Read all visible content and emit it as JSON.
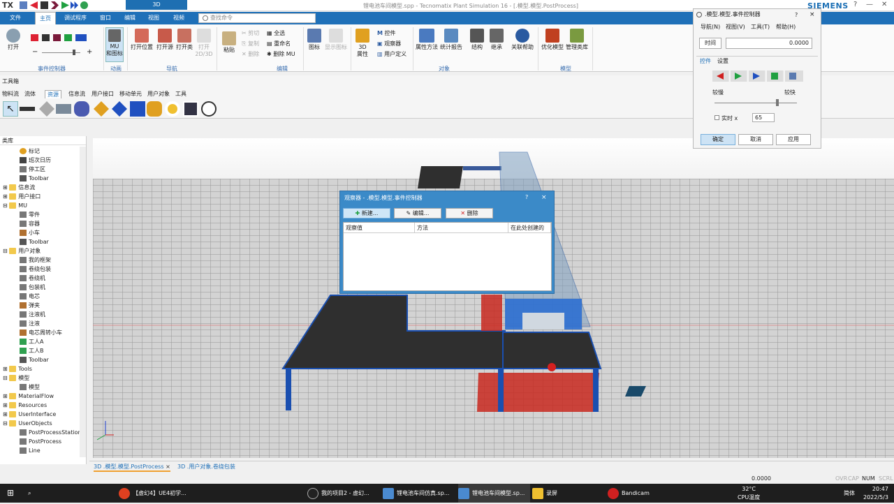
{
  "app": {
    "logo": "TX",
    "window_title": "锂电池车间模型.spp - Tecnomatix Plant Simulation 16 - [.模型.模型.PostProcess]",
    "context_tab": "3D",
    "brand": "SIEMENS"
  },
  "ribbon_tabs": [
    "文件",
    "主页",
    "调试程序",
    "窗口",
    "编辑",
    "视图",
    "视频"
  ],
  "search": {
    "placeholder": "查找命令"
  },
  "ribbon": {
    "open": "打开",
    "event_group": "事件控制器",
    "mu_line1": "MU",
    "mu_line2": "和图标",
    "anim_group": "动画",
    "open_loc": "打开位置",
    "open_src": "打开源",
    "open_class": "打开类",
    "open_2d": "打开",
    "open_2d_b": "2D/3D",
    "nav_group": "导航",
    "paste": "粘贴",
    "cut": "剪切",
    "copy": "复制",
    "delete": "删除",
    "select_all": "全选",
    "rename": "重命名",
    "delete_mu": "删除 MU",
    "edit_group": "编辑",
    "icon": "图标",
    "show_icon": "显示图标",
    "attr3d": "3D",
    "attr3d_b": "属性",
    "control": "控件",
    "observer": "观察器",
    "user_def": "用户定义",
    "props": "属性方法",
    "stats": "统计报告",
    "structure": "结构",
    "inherit": "继承",
    "related": "关联帮助",
    "obj_group": "对象",
    "optimize": "优化模型",
    "manage_lib": "管理类库",
    "model_group": "模型"
  },
  "toolbox": {
    "title": "工具箱",
    "tabs": [
      "物料流",
      "流体",
      "资源",
      "信息流",
      "用户接口",
      "移动单元",
      "用户对象",
      "工具"
    ]
  },
  "library": {
    "title": "类库",
    "items": [
      "标记",
      "班次日历",
      "停工区",
      "Toolbar",
      "信息流",
      "用户接口",
      "MU",
      "零件",
      "容器",
      "小车",
      "Toolbar",
      "用户对象",
      "我的框架",
      "卷绕包装",
      "卷绕机",
      "包装机",
      "电芯",
      "弹夹",
      "注液机",
      "注液",
      "电芯周转小车",
      "工人A",
      "工人B",
      "Toolbar",
      "Tools",
      "模型",
      "模型",
      "MaterialFlow",
      "Resources",
      "UserInterface",
      "UserObjects",
      "PostProcessStation",
      "PostProcess",
      "Line"
    ]
  },
  "observer_dialog": {
    "title": "观察器 - .模型.模型.事件控制器",
    "help": "?",
    "close": "×",
    "new": "新建...",
    "edit": "编辑...",
    "delete": "删除",
    "col_value": "观察值",
    "col_method": "方法",
    "col_created": "在此处创建的"
  },
  "event_controller": {
    "title": ".模型.模型.事件控制器",
    "help": "?",
    "close": "×",
    "menus": [
      "导航(N)",
      "视图(V)",
      "工具(T)",
      "帮助(H)"
    ],
    "time_label": "时间",
    "time_value": "0.0000",
    "tab_control": "控件",
    "tab_settings": "设置",
    "slower": "较慢",
    "faster": "较快",
    "realtime_label": "实时 x",
    "realtime_value": "65",
    "ok": "确定",
    "cancel": "取消",
    "apply": "应用"
  },
  "bottom_tabs": [
    {
      "label": "3D .模型.模型.PostProcess",
      "close": "×"
    },
    {
      "label": "3D .用户对象.卷绕包装"
    }
  ],
  "status": {
    "time": "0.0000",
    "ovr": "OVR",
    "cap": "CAP",
    "num": "NUM",
    "scrl": "SCRL"
  },
  "taskbar": {
    "items": [
      "【虚幻4】UE4初学...",
      "我的项目2 - 虚幻...",
      "锂电池车间仿真.sp...",
      "锂电池车间模型.sp...",
      "录屏",
      "Bandicam"
    ],
    "temp": "32°C",
    "temp_label": "CPU温度",
    "lang": "简体",
    "clock_time": "20:47",
    "clock_date": "2022/5/3"
  },
  "colors": {
    "ribbon_blue": "#1f70b8",
    "dialog_blue": "#3b8ac8",
    "conveyor_dark": "#2f2f2f",
    "frame_blue": "#1a4fb0",
    "hatch_red": "#c8281e"
  }
}
